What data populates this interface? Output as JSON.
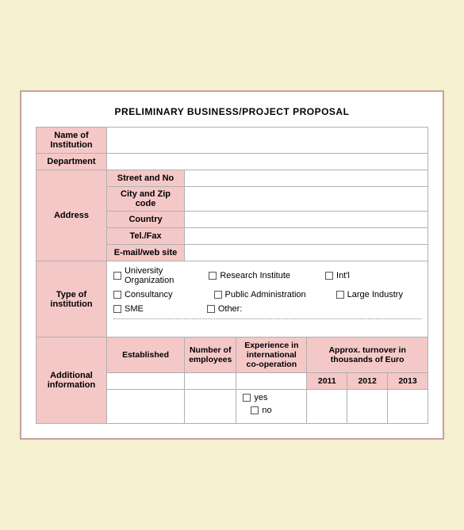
{
  "title": "PRELIMINARY BUSINESS/PROJECT PROPOSAL",
  "form": {
    "rows": [
      {
        "label": "Name of\nInstitution",
        "value": ""
      },
      {
        "label": "Department",
        "value": ""
      },
      {
        "label_address": "Address",
        "inner_rows": [
          {
            "inner_label": "Street and No",
            "value": ""
          },
          {
            "inner_label": "City and Zip code",
            "value": ""
          },
          {
            "inner_label": "Country",
            "value": ""
          },
          {
            "inner_label": "Tel./Fax",
            "value": ""
          },
          {
            "inner_label": "E-mail/web site",
            "value": ""
          }
        ]
      }
    ],
    "type_of_institution": {
      "label": "Type of\ninstitution",
      "options_row1": [
        {
          "label": "University\nOrganization"
        },
        {
          "label": "Research Institute"
        },
        {
          "label": "Int'l"
        }
      ],
      "options_row2": [
        {
          "label": "Consultancy"
        },
        {
          "label": "Public Administration"
        },
        {
          "label": "Large Industry"
        }
      ],
      "options_row3": [
        {
          "label": "SME"
        },
        {
          "label": "Other:"
        }
      ]
    },
    "additional": {
      "label": "Additional\ninformation",
      "sub_headers": [
        {
          "label": "Established"
        },
        {
          "label": "Number of employees"
        },
        {
          "label": "Experience in international co-operation"
        },
        {
          "label": "Approx. turnover in thousands of Euro"
        }
      ],
      "turnover_years": [
        "2011",
        "2012",
        "2013"
      ],
      "yes_label": "yes",
      "no_label": "no"
    }
  }
}
